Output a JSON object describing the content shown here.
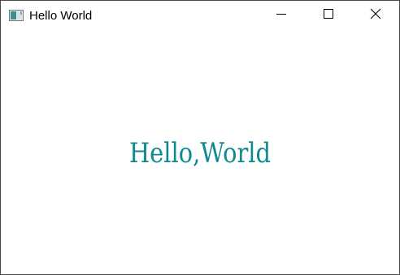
{
  "window": {
    "title": "Hello World",
    "icon": "app-window-icon",
    "buttons": {
      "minimize": "minimize-icon",
      "maximize": "maximize-icon",
      "close": "close-icon"
    }
  },
  "content": {
    "message": "Hello,World",
    "message_color": "#0f8a8f"
  }
}
